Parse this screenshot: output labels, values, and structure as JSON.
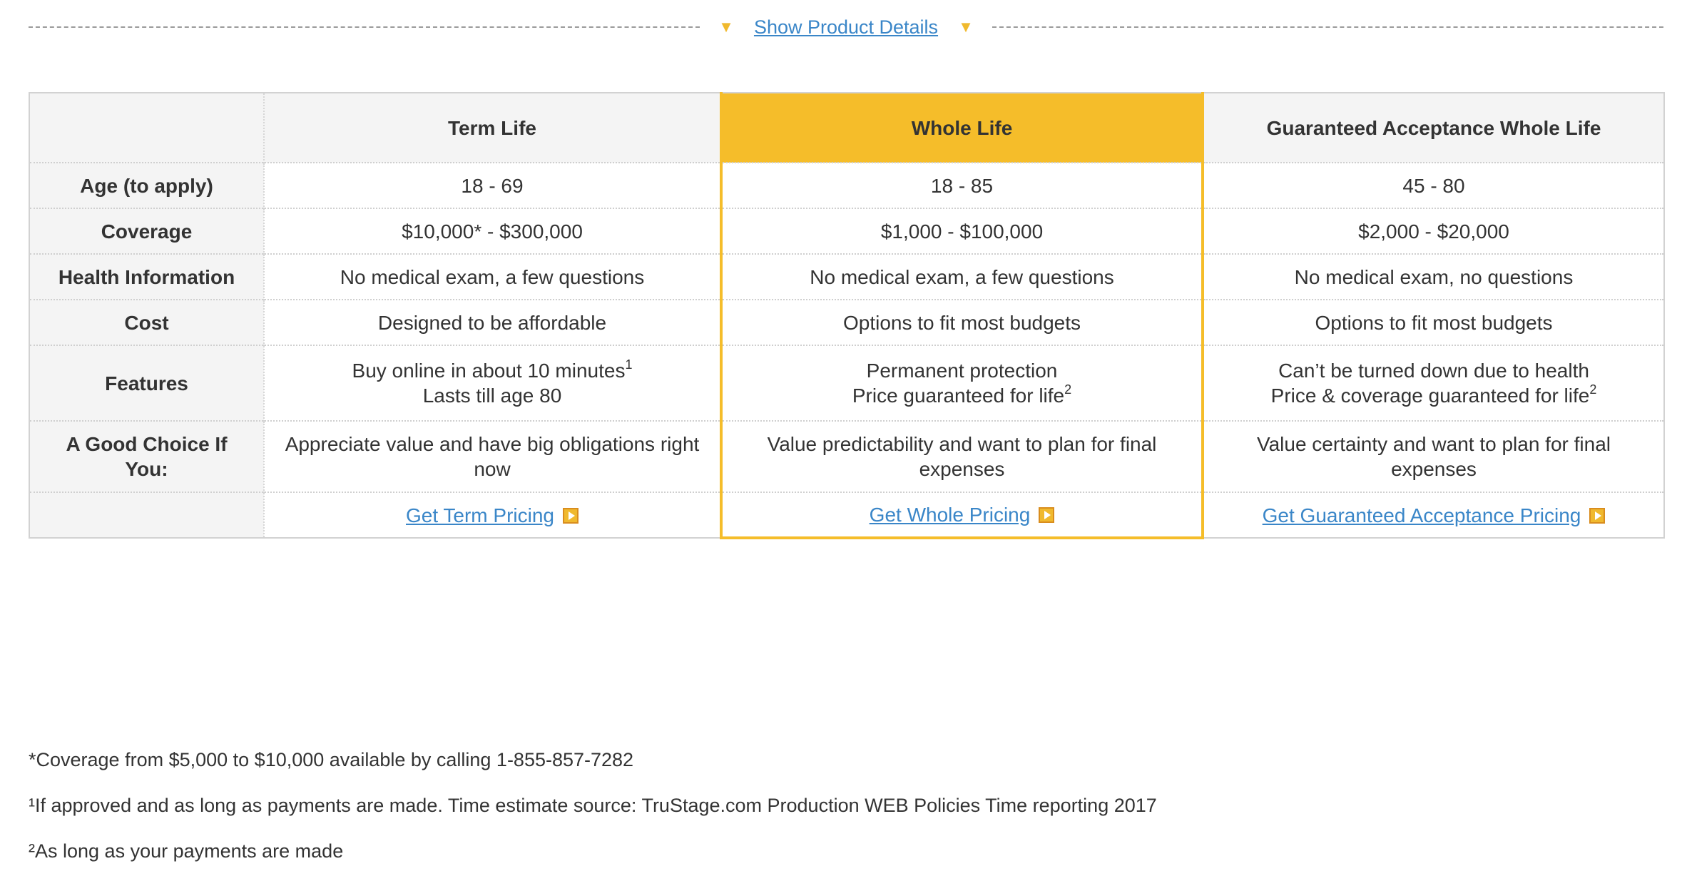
{
  "details": {
    "link": "Show Product Details"
  },
  "table": {
    "headers": [
      "Term Life",
      "Whole Life",
      "Guaranteed Acceptance Whole Life"
    ],
    "rows": [
      {
        "label": "Age (to apply)",
        "cells": [
          "18 - 69",
          "18 - 85",
          "45 - 80"
        ]
      },
      {
        "label": "Coverage",
        "cells": [
          "$10,000* - $300,000",
          "$1,000 - $100,000",
          "$2,000 - $20,000"
        ]
      },
      {
        "label": "Health Information",
        "cells": [
          "No medical exam, a few questions",
          "No medical exam, a few questions",
          "No medical exam, no questions"
        ]
      },
      {
        "label": "Cost",
        "cells": [
          "Designed to be affordable",
          "Options to fit most budgets",
          "Options to fit most budgets"
        ]
      },
      {
        "label": "Features",
        "cells": [
          {
            "line1": "Buy online in about 10 minutes",
            "sup1": "1",
            "line2": "Lasts till age 80",
            "sup2": ""
          },
          {
            "line1": "Permanent protection",
            "sup1": "",
            "line2": "Price guaranteed for life",
            "sup2": "2"
          },
          {
            "line1": "Can’t be turned down due to health",
            "sup1": "",
            "line2": "Price & coverage guaranteed for life",
            "sup2": "2"
          }
        ]
      },
      {
        "label": "A Good Choice If You:",
        "cells": [
          "Appreciate value and have big obligations right now",
          "Value predictability and want to plan for final expenses",
          "Value certainty and want to plan for final expenses"
        ]
      }
    ],
    "links": [
      "Get Term Pricing",
      "Get Whole Pricing",
      "Get Guaranteed Acceptance Pricing"
    ]
  },
  "footnotes": [
    "*Coverage from $5,000 to $10,000 available by calling 1-855-857-7282",
    "¹If approved and as long as payments are made. Time estimate source: TruStage.com Production WEB Policies Time reporting 2017",
    "²As long as your payments are made"
  ],
  "colors": {
    "highlight": "#f5bd2a",
    "link": "#3a86c8",
    "label_bg": "#f4f4f4"
  },
  "icons": [
    "triangle-down-icon",
    "play-arrow-icon"
  ]
}
